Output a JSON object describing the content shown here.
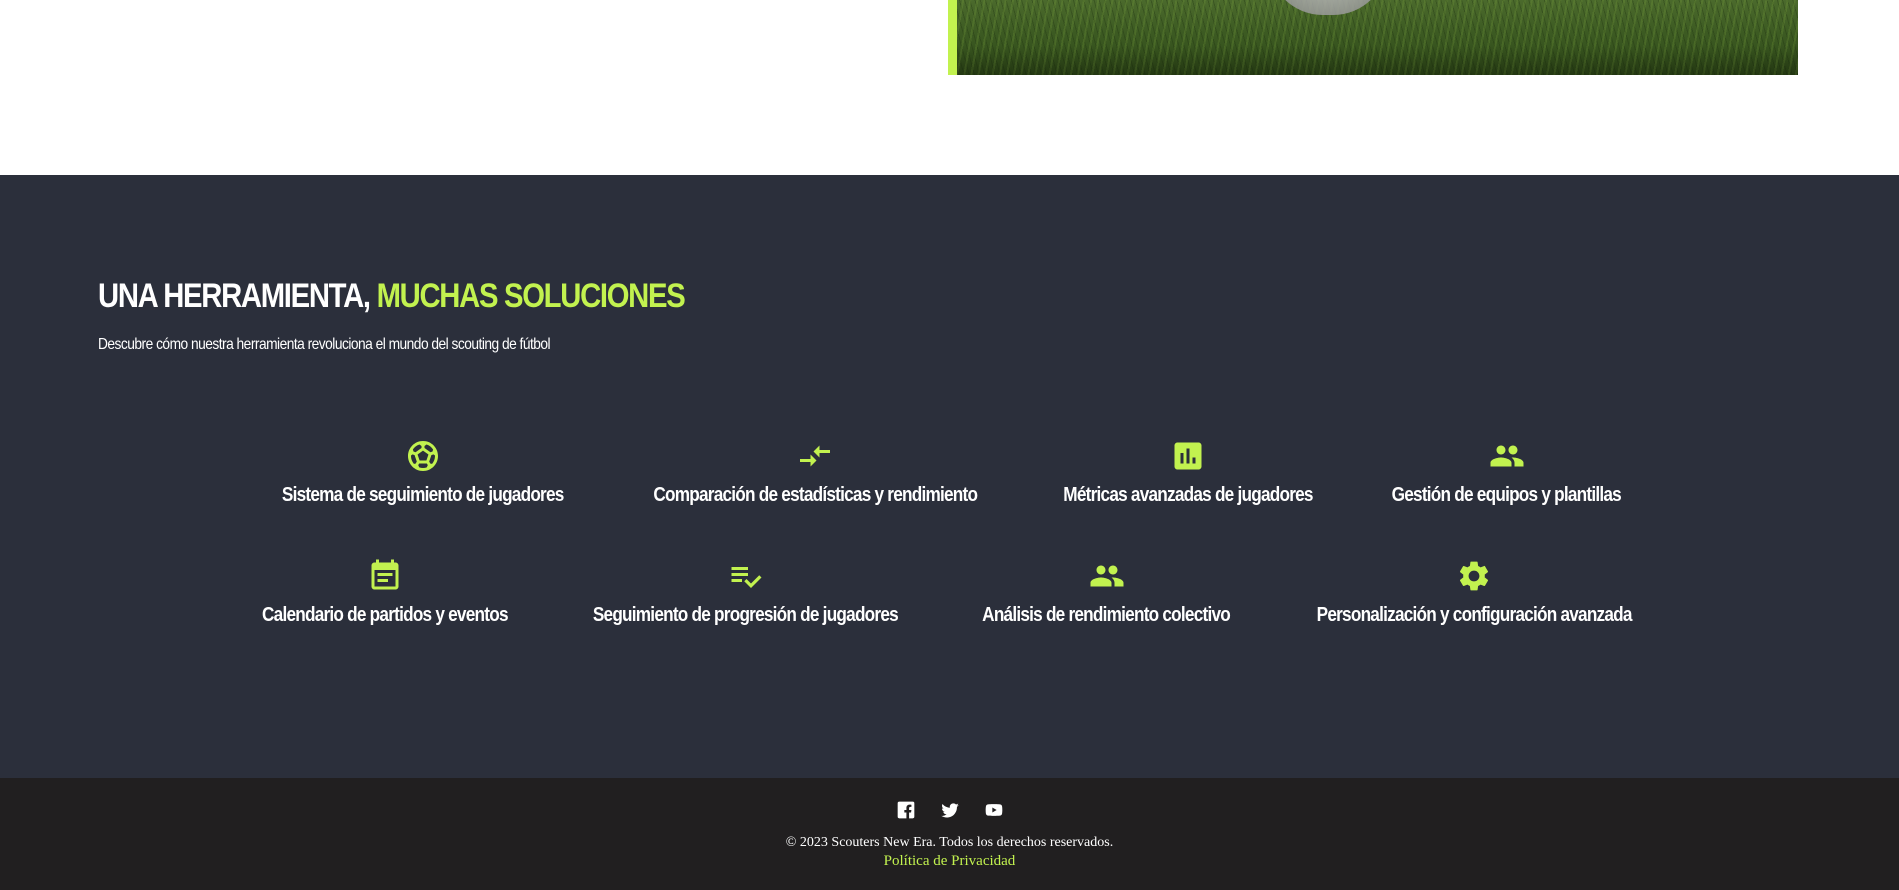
{
  "colors": {
    "accent": "#c2f24f",
    "section_bg": "#2b2f3b",
    "footer_bg": "#211f20",
    "text": "#ffffff"
  },
  "features_section": {
    "title_main": "UNA HERRAMIENTA,",
    "title_highlight": "MUCHAS SOLUCIONES",
    "subtitle": "Descubre cómo nuestra herramienta revoluciona el mundo del scouting de fútbol",
    "row1": [
      {
        "icon": "soccer-ball-icon",
        "label": "Sistema de seguimiento de jugadores"
      },
      {
        "icon": "compare-arrows-icon",
        "label": "Comparación de estadísticas y rendimiento"
      },
      {
        "icon": "bar-chart-icon",
        "label": "Métricas avanzadas de jugadores"
      },
      {
        "icon": "people-icon",
        "label": "Gestión de equipos y plantillas"
      }
    ],
    "row2": [
      {
        "icon": "calendar-icon",
        "label": "Calendario de partidos y eventos"
      },
      {
        "icon": "playlist-check-icon",
        "label": "Seguimiento de progresión de jugadores"
      },
      {
        "icon": "people-icon",
        "label": "Análisis de rendimiento colectivo"
      },
      {
        "icon": "gear-icon",
        "label": "Personalización y configuración avanzada"
      }
    ]
  },
  "footer": {
    "social": [
      "facebook-icon",
      "twitter-icon",
      "youtube-icon"
    ],
    "copyright": "© 2023 Scouters New Era. Todos los derechos reservados.",
    "privacy_link": "Política de Privacidad"
  }
}
